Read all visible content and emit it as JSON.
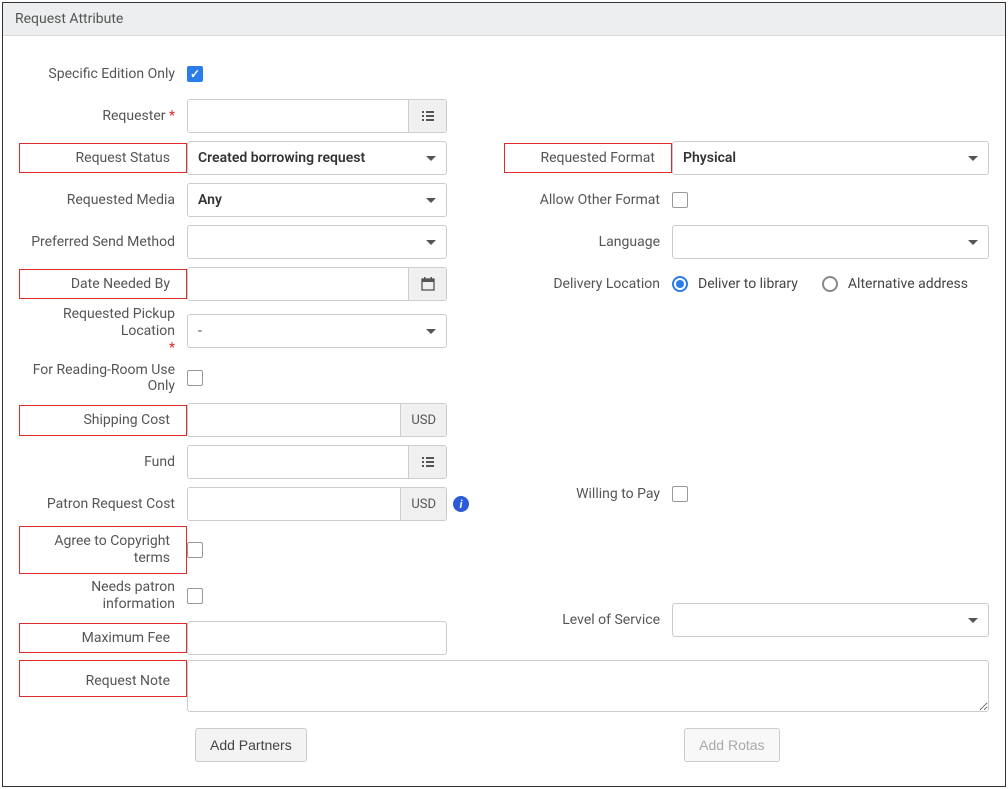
{
  "panel": {
    "title": "Request Attribute"
  },
  "left": {
    "specific_edition_only": {
      "label": "Specific Edition Only",
      "checked": true
    },
    "requester": {
      "label": "Requester",
      "value": ""
    },
    "request_status": {
      "label": "Request Status",
      "value": "Created borrowing request"
    },
    "requested_media": {
      "label": "Requested Media",
      "value": "Any"
    },
    "preferred_send_method": {
      "label": "Preferred Send Method",
      "value": ""
    },
    "date_needed_by": {
      "label": "Date Needed By",
      "value": ""
    },
    "requested_pickup_location": {
      "label": "Requested Pickup Location",
      "value": "-"
    },
    "reading_room": {
      "label": "For Reading-Room Use Only",
      "checked": false
    },
    "shipping_cost": {
      "label": "Shipping Cost",
      "value": "",
      "currency": "USD"
    },
    "fund": {
      "label": "Fund",
      "value": ""
    },
    "patron_request_cost": {
      "label": "Patron Request Cost",
      "value": "",
      "currency": "USD"
    },
    "agree_copyright": {
      "label": "Agree to Copyright terms",
      "checked": false
    },
    "needs_patron_info": {
      "label": "Needs patron information",
      "checked": false
    },
    "maximum_fee": {
      "label": "Maximum Fee",
      "value": ""
    },
    "request_note": {
      "label": "Request Note",
      "value": ""
    }
  },
  "right": {
    "requested_format": {
      "label": "Requested Format",
      "value": "Physical"
    },
    "allow_other_format": {
      "label": "Allow Other Format",
      "checked": false
    },
    "language": {
      "label": "Language",
      "value": ""
    },
    "delivery_location": {
      "label": "Delivery Location",
      "options": [
        {
          "label": "Deliver to library",
          "checked": true
        },
        {
          "label": "Alternative address",
          "checked": false
        }
      ]
    },
    "willing_to_pay": {
      "label": "Willing to Pay",
      "checked": false
    },
    "level_of_service": {
      "label": "Level of Service",
      "value": ""
    }
  },
  "buttons": {
    "add_partners": "Add Partners",
    "add_rotas": "Add Rotas"
  }
}
